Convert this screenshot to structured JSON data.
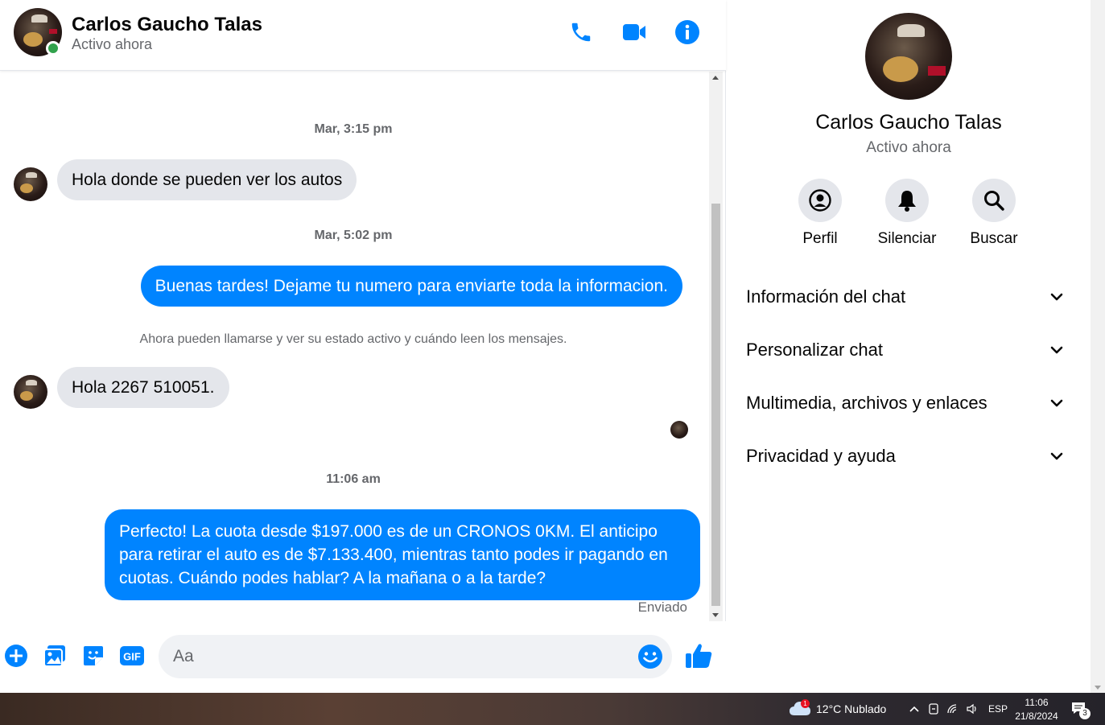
{
  "contact": {
    "name": "Carlos Gaucho Talas",
    "status": "Activo ahora"
  },
  "messages": [
    {
      "type": "time",
      "text": "Mar, 3:15 pm"
    },
    {
      "type": "in",
      "text": "Hola donde se pueden ver los autos"
    },
    {
      "type": "time",
      "text": "Mar, 5:02 pm"
    },
    {
      "type": "out",
      "text": "Buenas tardes! Dejame tu numero para enviarte toda la informacion."
    },
    {
      "type": "notice",
      "text": "Ahora pueden llamarse y ver su estado activo y cuándo leen los mensajes."
    },
    {
      "type": "in",
      "text": "Hola 2267 510051."
    },
    {
      "type": "time",
      "text": "11:06 am"
    },
    {
      "type": "out",
      "text": "Perfecto! La cuota desde $197.000 es de un CRONOS 0KM. El anticipo para retirar el auto es de $7.133.400, mientras tanto podes ir pagando en cuotas. Cuándo podes hablar? A la mañana o a la tarde?"
    }
  ],
  "sent_label": "Enviado",
  "composer": {
    "placeholder": "Aa",
    "gif_label": "GIF"
  },
  "info_panel": {
    "actions": [
      {
        "label": "Perfil",
        "icon": "profile-icon"
      },
      {
        "label": "Silenciar",
        "icon": "bell-icon"
      },
      {
        "label": "Buscar",
        "icon": "search-icon"
      }
    ],
    "sections": [
      {
        "label": "Información del chat"
      },
      {
        "label": "Personalizar chat"
      },
      {
        "label": "Multimedia, archivos y enlaces"
      },
      {
        "label": "Privacidad y ayuda"
      }
    ]
  },
  "taskbar": {
    "weather": "12°C  Nublado",
    "weather_badge": "1",
    "language": "ESP",
    "time": "11:06",
    "date": "21/8/2024",
    "notification_count": "3"
  },
  "colors": {
    "accent": "#0084ff",
    "incoming_bubble": "#e4e6eb",
    "online": "#31a24c"
  }
}
